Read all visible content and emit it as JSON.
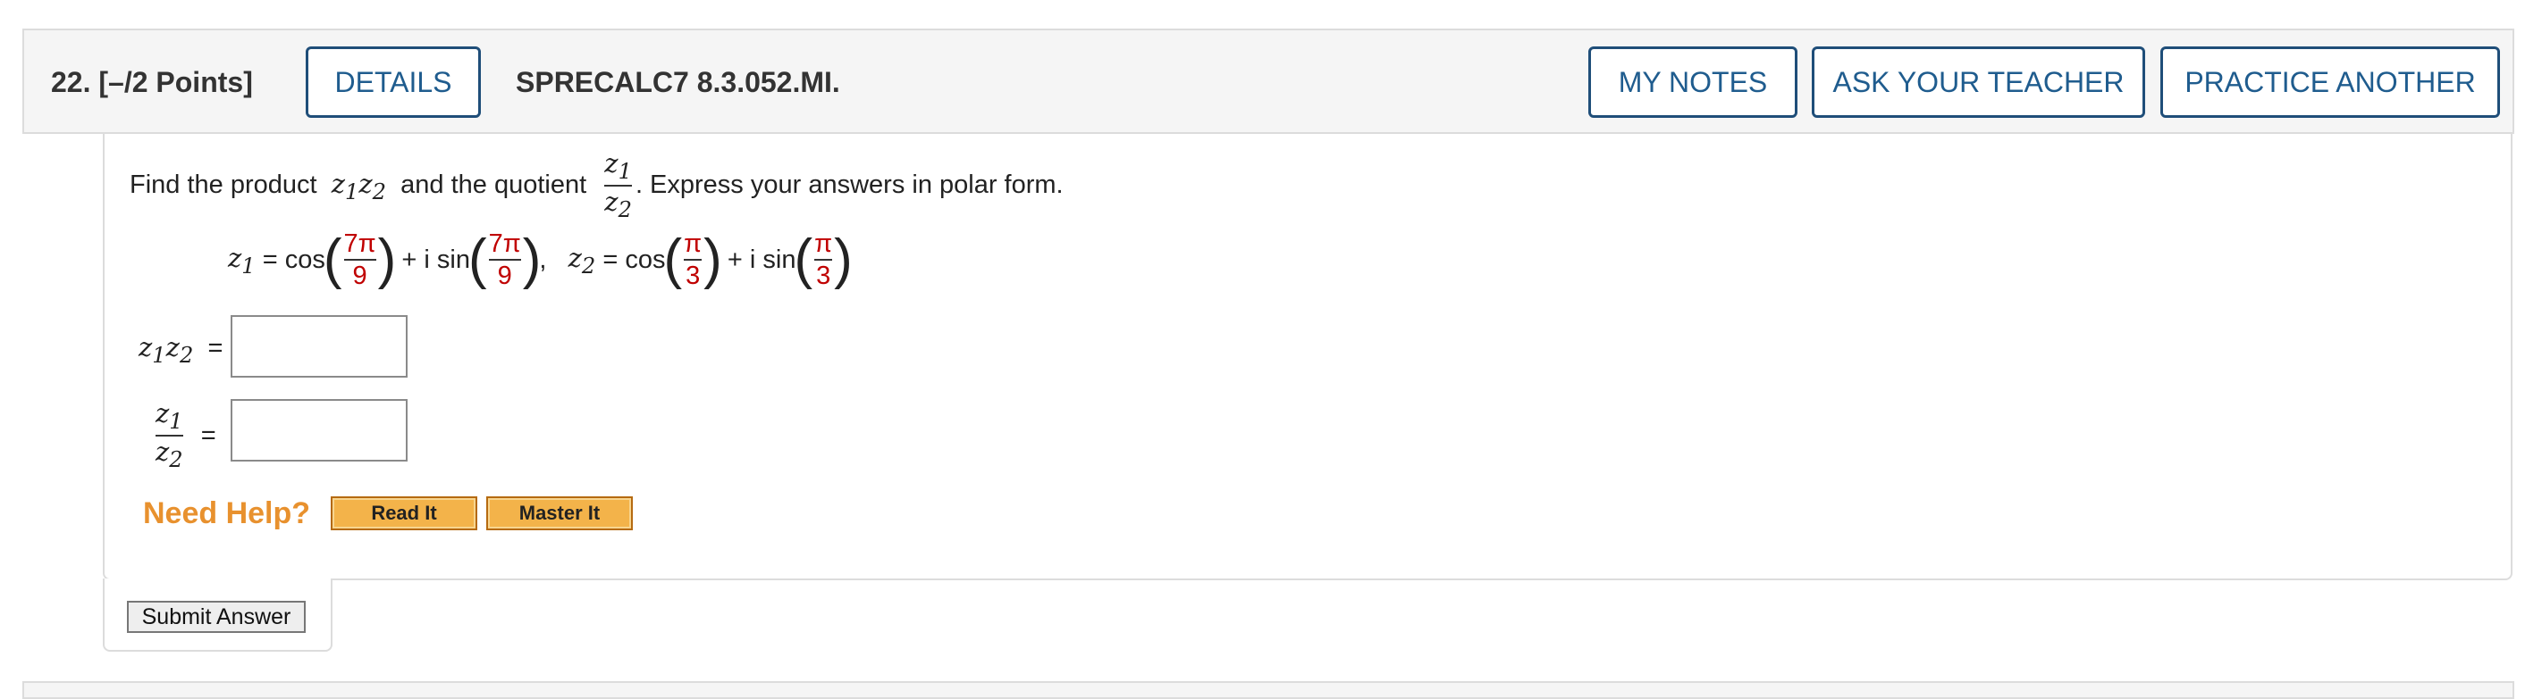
{
  "question": {
    "number": "22.",
    "points": "[–/2 Points]",
    "details_label": "DETAILS",
    "code": "SPRECALC7 8.3.052.MI.",
    "my_notes_label": "MY NOTES",
    "ask_teacher_label": "ASK YOUR TEACHER",
    "practice_another_label": "PRACTICE ANOTHER"
  },
  "problem": {
    "text_before": "Find the product",
    "product_expr": "z1z2",
    "text_middle": "and the quotient",
    "quotient_num": "z1",
    "quotient_den": "z2",
    "text_after": ". Express your answers in polar form."
  },
  "given": {
    "z1_label": "z1",
    "equals": "=",
    "cos": "cos",
    "sin": "sin",
    "plus_i": "+ i",
    "z1_angle_num": "7π",
    "z1_angle_den": "9",
    "comma": ",",
    "z2_label": "z2",
    "z2_angle_num": "π",
    "z2_angle_den": "3"
  },
  "answers": {
    "product_label": "z1z2",
    "quotient_num": "z1",
    "quotient_den": "z2",
    "equals": "=",
    "product_value": "",
    "quotient_value": ""
  },
  "help": {
    "need_help": "Need Help?",
    "read_it": "Read It",
    "master_it": "Master It"
  },
  "submit_label": "Submit Answer",
  "colors": {
    "accent": "#1f5c8e",
    "help": "#e8912e",
    "button": "#f3b34a",
    "fraction_red": "#c00000"
  }
}
